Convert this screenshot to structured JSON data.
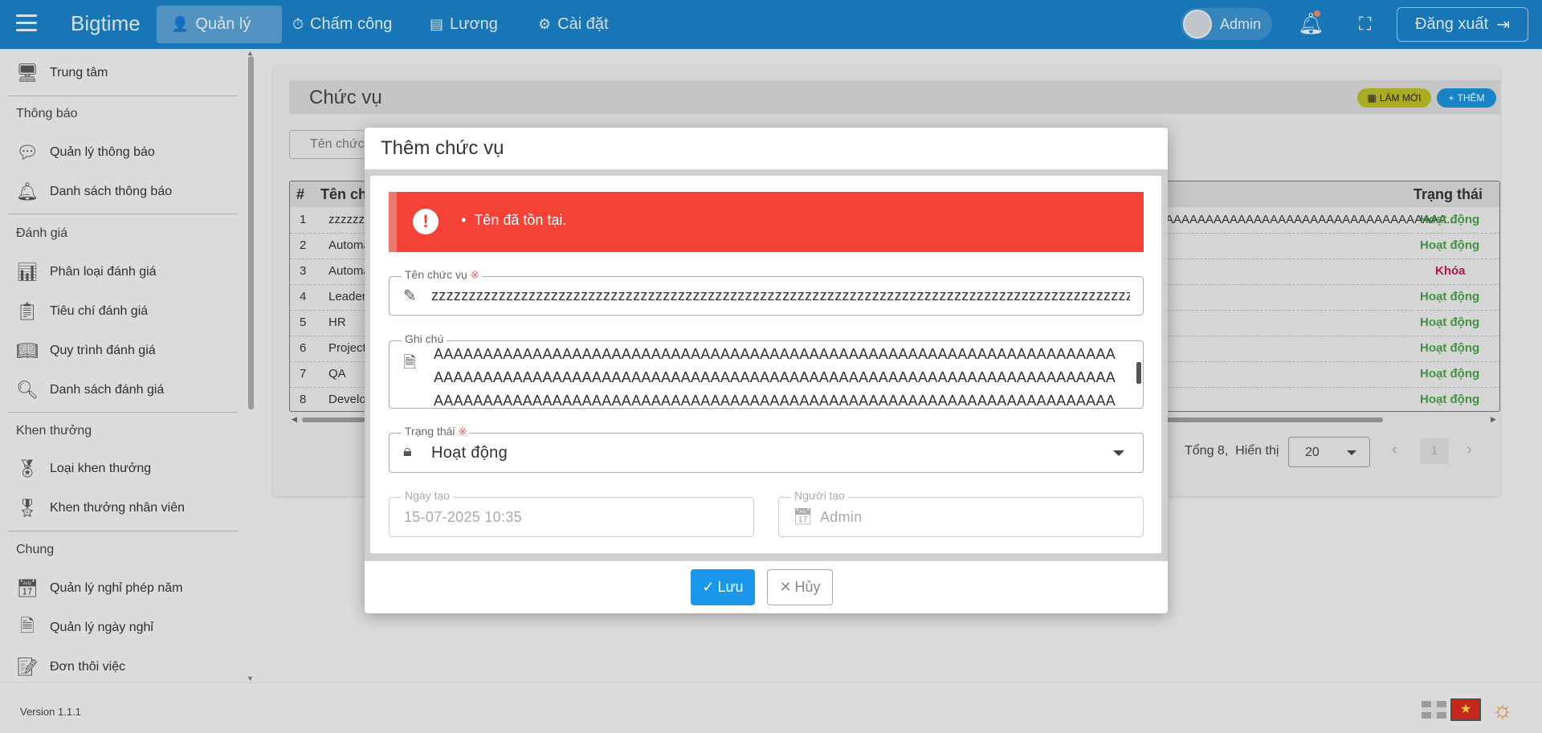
{
  "app": {
    "brand": "Bigtime",
    "version": "Version 1.1.1"
  },
  "nav": {
    "tabs": [
      {
        "label": "Quản lý",
        "icon": "users-icon",
        "active": true
      },
      {
        "label": "Chấm công",
        "icon": "stopwatch-icon"
      },
      {
        "label": "Lương",
        "icon": "ledger-icon"
      },
      {
        "label": "Cài đặt",
        "icon": "gears-icon"
      }
    ],
    "user": "Admin",
    "logout": "Đăng xuất"
  },
  "sidebar": {
    "items": [
      {
        "label": "Trung tâm",
        "icon": "monitor-icon"
      },
      {
        "section": "Thông báo"
      },
      {
        "label": "Quản lý thông báo",
        "icon": "message-icon"
      },
      {
        "label": "Danh sách thông báo",
        "icon": "bell-icon"
      },
      {
        "section": "Đánh giá"
      },
      {
        "label": "Phân loại đánh giá",
        "icon": "chart-icon"
      },
      {
        "label": "Tiêu chí đánh giá",
        "icon": "clipboard-icon"
      },
      {
        "label": "Quy trình đánh giá",
        "icon": "book-icon"
      },
      {
        "label": "Danh sách đánh giá",
        "icon": "search-doc-icon"
      },
      {
        "section": "Khen thưởng"
      },
      {
        "label": "Loại khen thưởng",
        "icon": "certificate-icon"
      },
      {
        "label": "Khen thưởng nhân viên",
        "icon": "badge-icon"
      },
      {
        "section": "Chung"
      },
      {
        "label": "Quản lý nghỉ phép năm",
        "icon": "calendar-icon"
      },
      {
        "label": "Quản lý ngày nghỉ",
        "icon": "doc-alert-icon"
      },
      {
        "label": "Đơn thôi việc",
        "icon": "resign-icon"
      }
    ]
  },
  "page": {
    "title": "Chức vụ",
    "refresh_label": "LÀM MỚI",
    "add_label": "THÊM",
    "search_placeholder": "Tên chức vụ",
    "table": {
      "headers": {
        "index": "#",
        "name": "Tên chức vụ",
        "status": "Trạng thái"
      },
      "note_overflow": "AAAAAAAAAAAAAAAAAAAAAAAAAAAAAAAAAAA...",
      "rows": [
        {
          "index": "1",
          "name": "zzzzzzzzzzzzzzz",
          "status": "Hoạt động",
          "status_color": "#43a047"
        },
        {
          "index": "2",
          "name": "Automation Tester",
          "status": "Hoạt động",
          "status_color": "#43a047"
        },
        {
          "index": "3",
          "name": "Automation",
          "status": "Khóa",
          "status_color": "#c2185b"
        },
        {
          "index": "4",
          "name": "Leader",
          "status": "Hoạt động",
          "status_color": "#43a047"
        },
        {
          "index": "5",
          "name": "HR",
          "status": "Hoạt động",
          "status_color": "#43a047"
        },
        {
          "index": "6",
          "name": "Project Manager",
          "status": "Hoạt động",
          "status_color": "#43a047"
        },
        {
          "index": "7",
          "name": "QA",
          "status": "Hoạt động",
          "status_color": "#43a047"
        },
        {
          "index": "8",
          "name": "Developer",
          "status": "Hoạt động",
          "status_color": "#43a047"
        }
      ]
    },
    "pager": {
      "total": "Tổng 8,",
      "show_label": "Hiển thị",
      "page_size": "20",
      "current_page": "1"
    }
  },
  "modal": {
    "title": "Thêm chức vụ",
    "error": "Tên đã tồn tại.",
    "name_label": "Tên chức vụ",
    "required_mark": "※",
    "name_value": "zzzzzzzzzzzzzzzzzzzzzzzzzzzzzzzzzzzzzzzzzzzzzzzzzzzzzzzzzzzzzzzzzzzzzzzzzzzzzzzzzzzzzzzzzzzzzzzzzzzzzz",
    "note_label": "Ghi chú",
    "note_value": "AAAAAAAAAAAAAAAAAAAAAAAAAAAAAAAAAAAAAAAAAAAAAAAAAAAAAAAAAAAAAAAAAAAAAAAAAAAAAAAAAAAAAAAAAAAAAAAAAAAAAAAAAAAAAAAAAAAAAAAAAAAAAAAAAAAAAAAAAAAAAAAAAAAAAAAAAAAAAAAAAAAAAAAAAAAAAAAAAAAAAAAAAAAAAAAAAAAAAAAAAAAAAAAA",
    "status_label": "Trạng thái",
    "status_value": "Hoạt động",
    "created_date_label": "Ngày tạo",
    "created_date_value": "15-07-2025 10:35",
    "creator_label": "Người tạo",
    "creator_value": "Admin",
    "save_label": "Lưu",
    "cancel_label": "Hủy"
  }
}
